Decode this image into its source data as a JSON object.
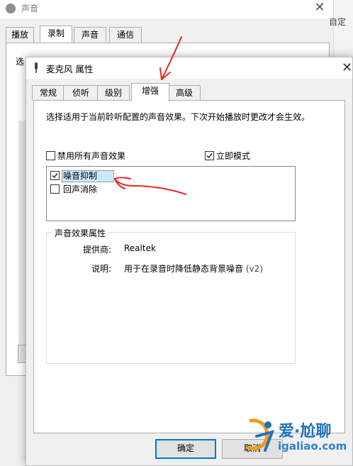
{
  "background_window": {
    "title": "声音",
    "close_glyph": "✕",
    "tabs": [
      "播放",
      "录制",
      "声音",
      "通信"
    ],
    "active_tab": "录制",
    "panel_text_fragment": "选",
    "right_edge_text": "自定"
  },
  "dialog": {
    "title": "麦克风 属性",
    "close_glyph": "✕",
    "tabs": [
      "常规",
      "侦听",
      "级别",
      "增强",
      "高级"
    ],
    "active_tab": "增强",
    "description": "选择适用于当前聆听配置的声音效果。下次开始播放时更改才会生效。",
    "disable_all_label": "禁用所有声音效果",
    "disable_all_checked": false,
    "immediate_mode_label": "立即模式",
    "immediate_mode_checked": true,
    "effects": [
      {
        "label": "噪音抑制",
        "checked": true,
        "selected": true
      },
      {
        "label": "回声消除",
        "checked": false,
        "selected": false
      }
    ],
    "properties": {
      "group_title": "声音效果属性",
      "provider_key": "提供商:",
      "provider_value": "Realtek",
      "description_key": "说明:",
      "description_value": "用于在录音时降低静态背景噪音",
      "version": "(v2)"
    },
    "buttons": {
      "ok": "确定",
      "cancel": "取消"
    }
  },
  "watermark": {
    "line1": "爱·尬聊",
    "line2": "igaliao.com"
  },
  "colors": {
    "annotation_red": "#e8262a",
    "selection_blue": "#cce8ff",
    "focus_blue": "#0078d7"
  }
}
